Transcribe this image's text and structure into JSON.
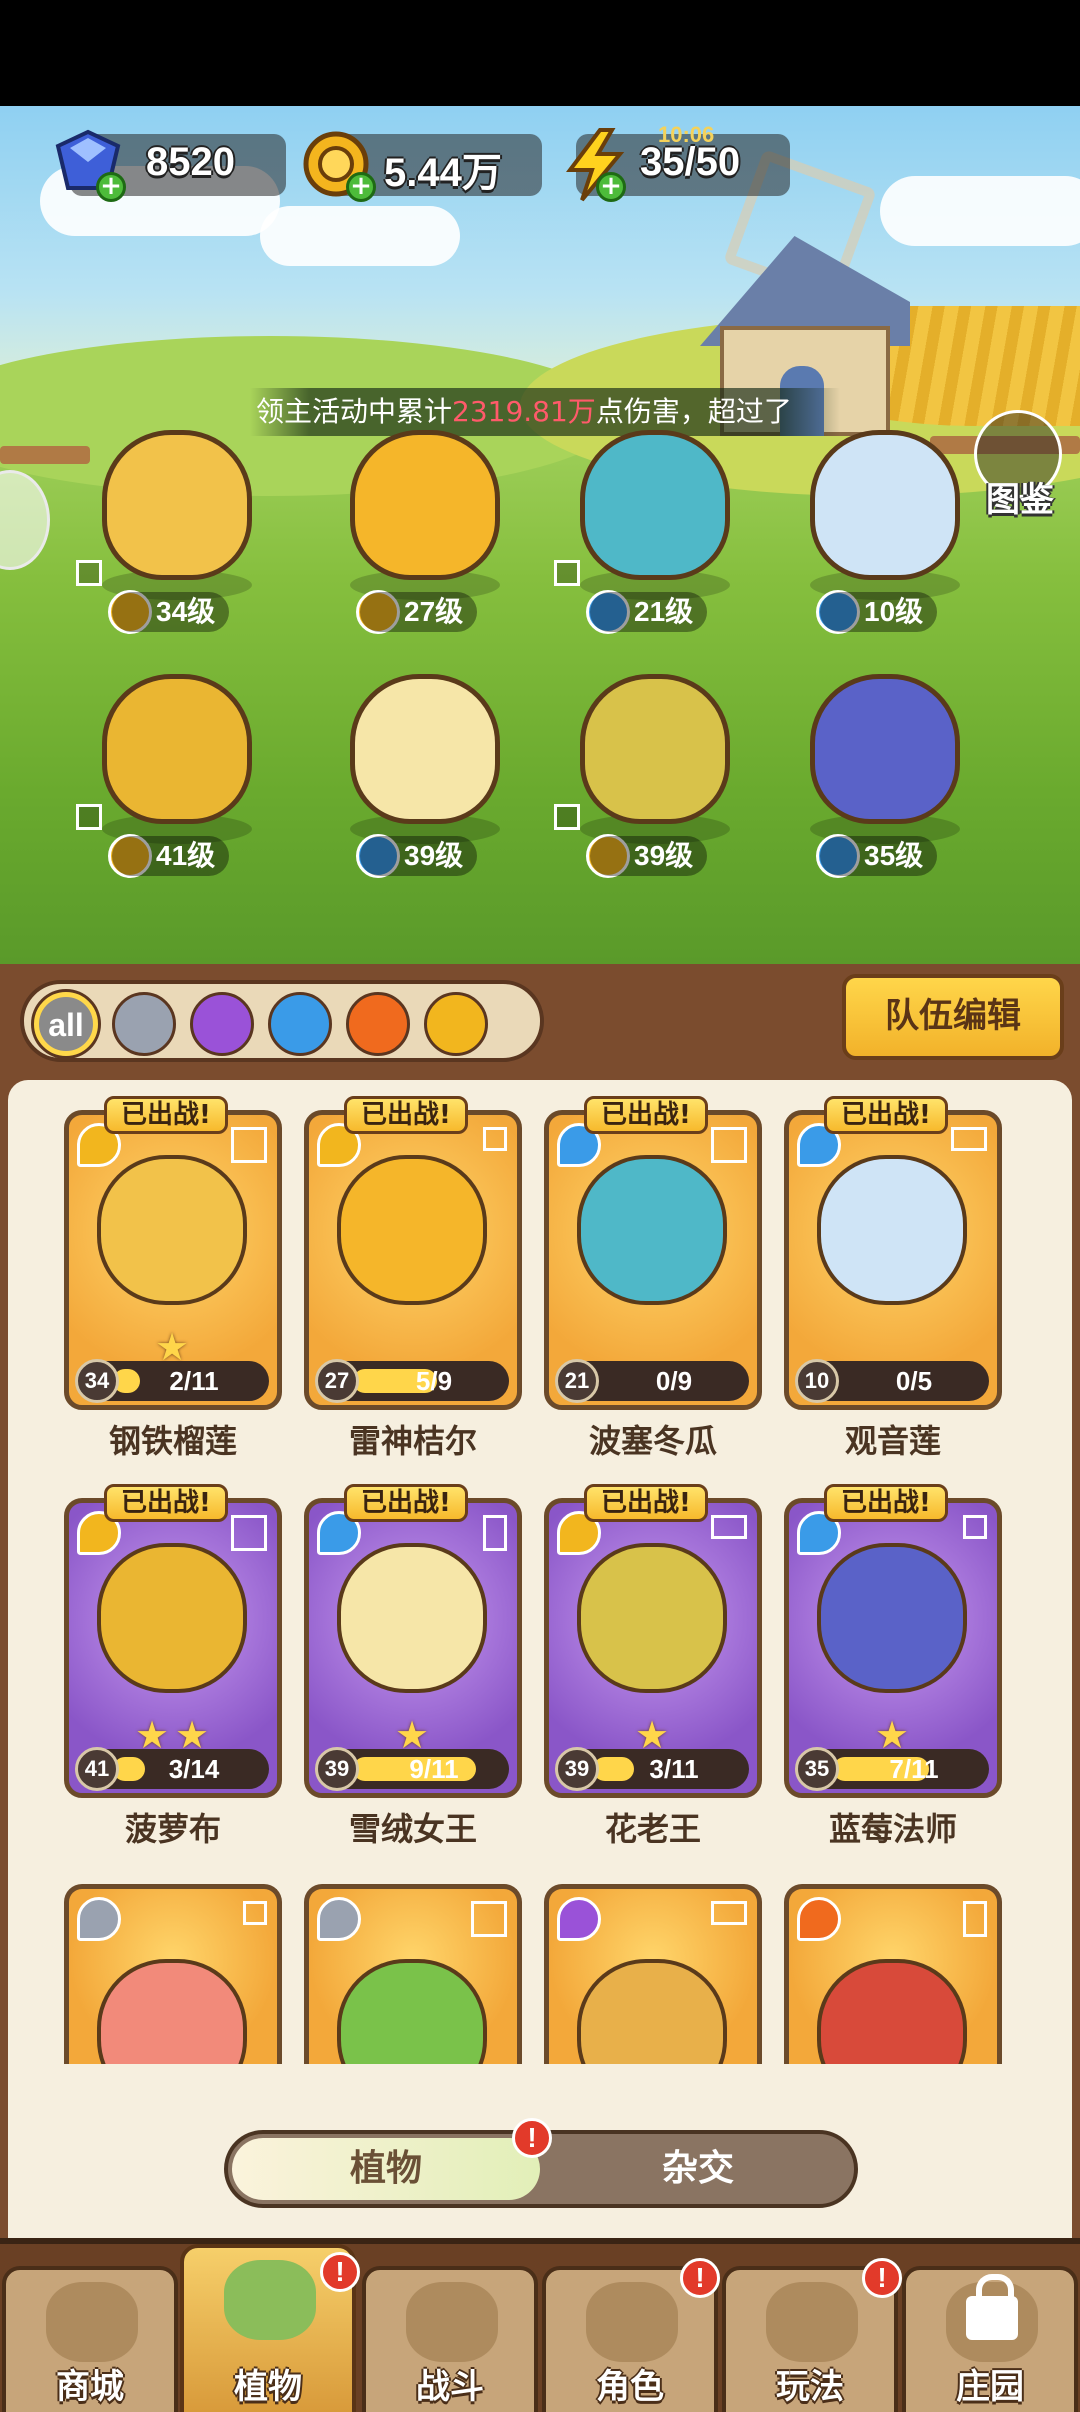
{
  "resources": {
    "gems": "8520",
    "coins": "5.44万",
    "energy": "35/50",
    "energy_timer": "10:06"
  },
  "marquee": {
    "prefix": "领主活动中累计",
    "highlight": "2319.81万",
    "suffix": "点伤害，超过了"
  },
  "codex_label": "图鉴",
  "team_heroes": [
    {
      "level": "34级",
      "element": "lightning"
    },
    {
      "level": "27级",
      "element": "lightning"
    },
    {
      "level": "21级",
      "element": "water"
    },
    {
      "level": "10级",
      "element": "water"
    },
    {
      "level": "41级",
      "element": "lightning"
    },
    {
      "level": "39级",
      "element": "water"
    },
    {
      "level": "39级",
      "element": "lightning"
    },
    {
      "level": "35级",
      "element": "water"
    }
  ],
  "filters": [
    "all",
    "sword-icon",
    "potion-icon",
    "water-drop-icon",
    "fire-icon",
    "lightning-icon"
  ],
  "team_edit_label": "队伍编辑",
  "deployed_label": "已出战!",
  "cards": [
    {
      "name": "钢铁榴莲",
      "level": "34",
      "progress": "2/11",
      "fraction": 0.18,
      "stars": 1,
      "element": "lightning"
    },
    {
      "name": "雷神桔尔",
      "level": "27",
      "progress": "5/9",
      "fraction": 0.56,
      "stars": 0,
      "element": "lightning"
    },
    {
      "name": "波塞冬瓜",
      "level": "21",
      "progress": "0/9",
      "fraction": 0.0,
      "stars": 0,
      "element": "water"
    },
    {
      "name": "观音莲",
      "level": "10",
      "progress": "0/5",
      "fraction": 0.0,
      "stars": 0,
      "element": "water"
    },
    {
      "name": "菠萝布",
      "level": "41",
      "progress": "3/14",
      "fraction": 0.21,
      "stars": 2,
      "element": "lightning"
    },
    {
      "name": "雪绒女王",
      "level": "39",
      "progress": "9/11",
      "fraction": 0.82,
      "stars": 1,
      "element": "water"
    },
    {
      "name": "花老王",
      "level": "39",
      "progress": "3/11",
      "fraction": 0.27,
      "stars": 1,
      "element": "lightning"
    },
    {
      "name": "蓝莓法师",
      "level": "35",
      "progress": "7/11",
      "fraction": 0.64,
      "stars": 1,
      "element": "water"
    }
  ],
  "segment": {
    "plants": "植物",
    "hybrid": "杂交"
  },
  "badge": "!",
  "nav": [
    "商城",
    "植物",
    "战斗",
    "角色",
    "玩法",
    "庄园"
  ],
  "colors": {
    "lightning": "#f2b61e",
    "water": "#3a9be8",
    "fire": "#f06a1e",
    "gold_card": "#f3a83a",
    "purple_card": "#8a56c8",
    "accent": "#ffd64a"
  }
}
